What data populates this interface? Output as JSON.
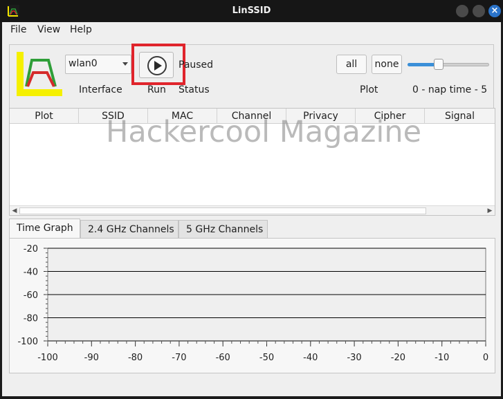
{
  "window": {
    "title": "LinSSID"
  },
  "menu": [
    "File",
    "View",
    "Help"
  ],
  "controls": {
    "interface_value": "wlan0",
    "interface_label": "Interface",
    "run_label": "Run",
    "status_value": "Paused",
    "status_label": "Status",
    "plot_all": "all",
    "plot_none": "none",
    "plot_label": "Plot",
    "nap_time": "0 - nap time - 5",
    "nap_slider_fraction": 0.38
  },
  "table": {
    "columns": [
      "Plot",
      "SSID",
      "MAC",
      "Channel",
      "Privacy",
      "Cipher",
      "Signal"
    ],
    "rows": []
  },
  "watermark": "Hackercool Magazine",
  "tabs": [
    "Time Graph",
    "2.4 GHz Channels",
    "5 GHz Channels"
  ],
  "colors": {
    "accent": "#3a8fd8",
    "highlight": "#e0242c",
    "close": "#2a73c9"
  },
  "chart_data": {
    "type": "line",
    "title": "",
    "xlabel": "",
    "ylabel": "",
    "xlim": [
      -100,
      0
    ],
    "ylim": [
      -100,
      -20
    ],
    "x_ticks": [
      -100,
      -90,
      -80,
      -70,
      -60,
      -50,
      -40,
      -30,
      -20,
      -10,
      0
    ],
    "y_ticks": [
      -20,
      -40,
      -60,
      -80,
      -100
    ],
    "grid": true,
    "series": []
  }
}
